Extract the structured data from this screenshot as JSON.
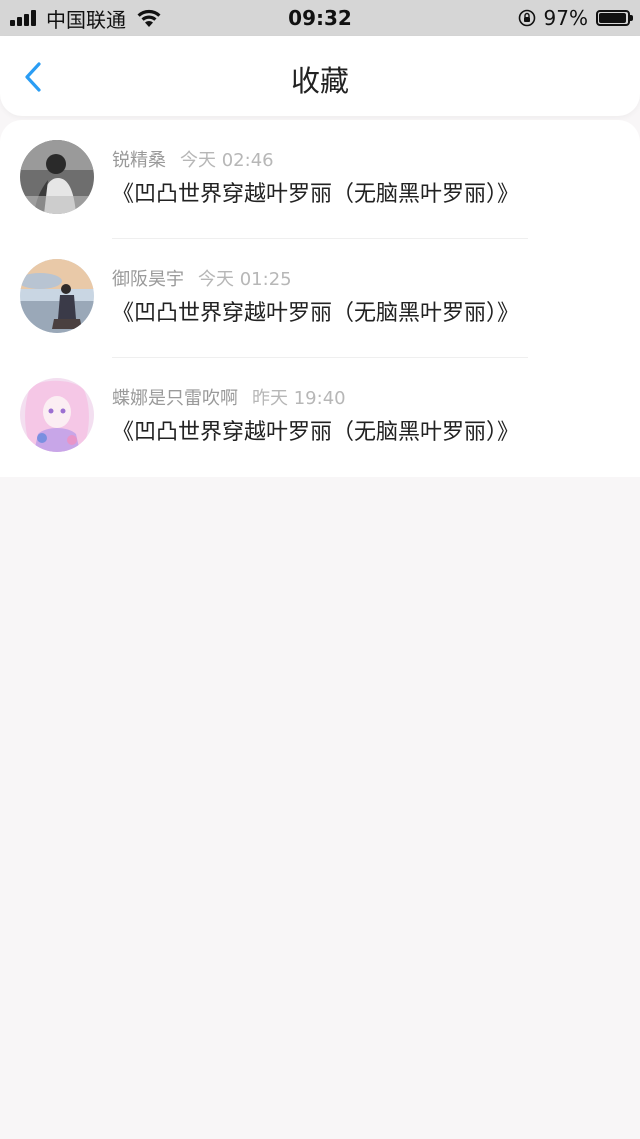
{
  "status_bar": {
    "carrier": "中国联通",
    "time": "09:32",
    "battery_percent": "97%",
    "battery_level": 0.97
  },
  "nav": {
    "title": "收藏"
  },
  "favorites": [
    {
      "user": "锐精桑",
      "time": "今天 02:46",
      "title": "《凹凸世界穿越叶罗丽（无脑黑叶罗丽）》"
    },
    {
      "user": "御阪昊宇",
      "time": "今天 01:25",
      "title": "《凹凸世界穿越叶罗丽（无脑黑叶罗丽）》"
    },
    {
      "user": "蝶娜是只雷吹啊",
      "time": "昨天 19:40",
      "title": "《凹凸世界穿越叶罗丽（无脑黑叶罗丽）》"
    }
  ],
  "colors": {
    "accent": "#2a9df4",
    "background": "#f8f6f7",
    "status_bar_bg": "#d6d6d6"
  }
}
